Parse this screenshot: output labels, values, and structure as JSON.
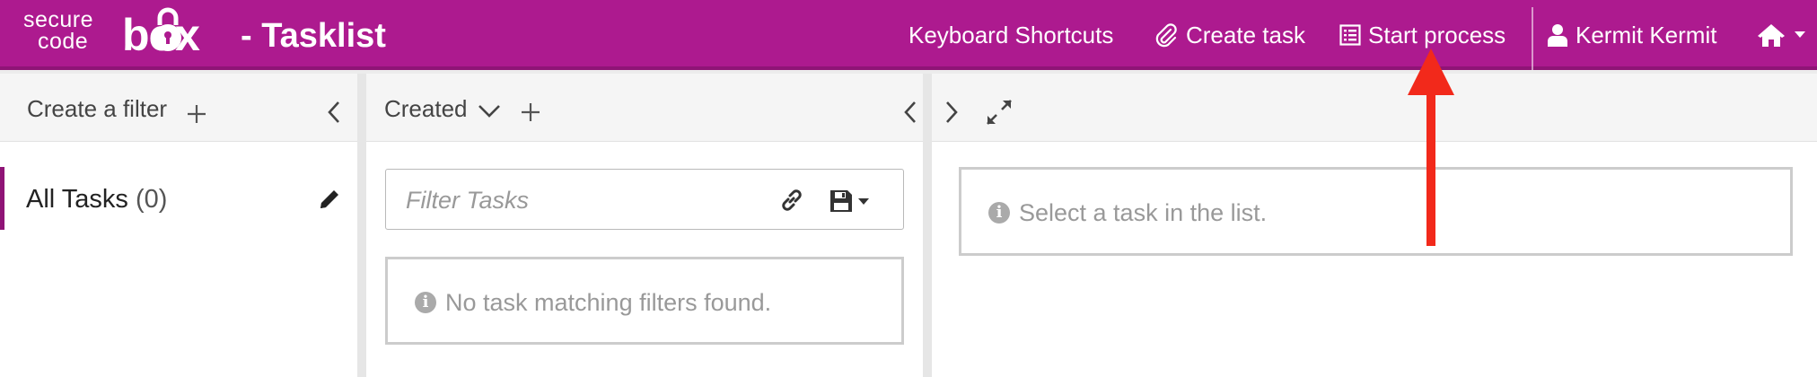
{
  "header": {
    "logo": {
      "word_secure": "secure",
      "word_code": "code",
      "word_box": "box",
      "brand_color": "#ad1a8f"
    },
    "title": "- Tasklist",
    "nav": {
      "shortcuts": "Keyboard Shortcuts",
      "create_task": "Create task",
      "start_process": "Start process",
      "user": "Kermit Kermit"
    },
    "icons": {
      "create_task": "paperclip-icon",
      "start_process": "list-icon",
      "user": "user-icon",
      "home": "home-icon"
    }
  },
  "filters_panel": {
    "header_label": "Create a filter",
    "items": [
      {
        "label": "All Tasks",
        "count": "(0)"
      }
    ]
  },
  "list_panel": {
    "sort_label": "Created",
    "search_placeholder": "Filter Tasks",
    "empty_message": "No task matching filters found."
  },
  "detail_panel": {
    "empty_message": "Select a task in the list."
  },
  "annotation": {
    "arrow_color": "#f2291b",
    "points_to": "Start process"
  }
}
